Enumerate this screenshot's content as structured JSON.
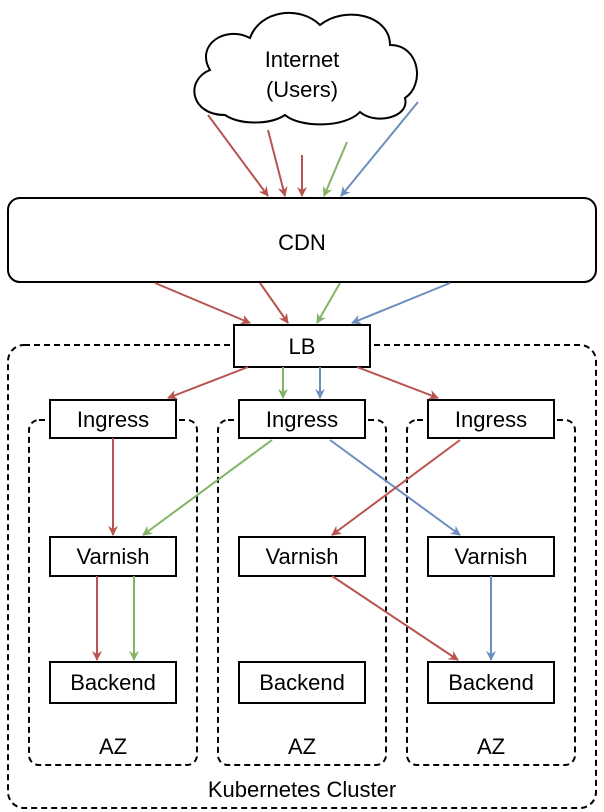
{
  "colors": {
    "red": "#b85450",
    "green": "#82b366",
    "blue": "#6c8ebf"
  },
  "internet": {
    "line1": "Internet",
    "line2": "(Users)"
  },
  "cdn": "CDN",
  "lb": "LB",
  "cluster": "Kubernetes Cluster",
  "zones": [
    {
      "ingress": "Ingress",
      "varnish": "Varnish",
      "backend": "Backend",
      "label": "AZ"
    },
    {
      "ingress": "Ingress",
      "varnish": "Varnish",
      "backend": "Backend",
      "label": "AZ"
    },
    {
      "ingress": "Ingress",
      "varnish": "Varnish",
      "backend": "Backend",
      "label": "AZ"
    }
  ]
}
